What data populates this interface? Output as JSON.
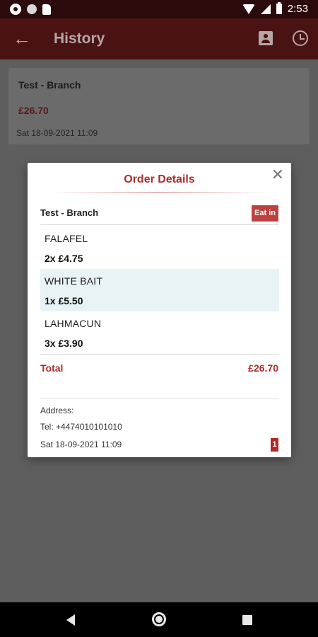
{
  "status_bar": {
    "time": "2:53",
    "icons": [
      "gear-icon",
      "dot-icon",
      "sd-card-icon",
      "wifi-icon",
      "signal-icon",
      "battery-icon"
    ]
  },
  "app_bar": {
    "title": "History",
    "back_icon": "arrow-left-icon",
    "actions": [
      "profile-icon",
      "history-icon"
    ],
    "background_color": "#4a1313"
  },
  "history_list": [
    {
      "branch": "Test - Branch",
      "total": "£26.70",
      "date": "Sat 18-09-2021 11:09"
    }
  ],
  "dialog": {
    "title": "Order Details",
    "branch": "Test - Branch",
    "order_type": "Eat in",
    "items": [
      {
        "name": "FALAFEL",
        "qty_price": "2x £4.75"
      },
      {
        "name": "WHITE BAIT",
        "qty_price": "1x £5.50"
      },
      {
        "name": "LAHMACUN",
        "qty_price": "3x £3.90"
      }
    ],
    "total_label": "Total",
    "total_value": "£26.70",
    "address_label": "Address:",
    "tel": "Tel: +4474010101010",
    "date": "Sat 18-09-2021 11:09",
    "badge": "1",
    "accent_color": "#b02a2a",
    "highlight_row_color": "#e8f3f6"
  },
  "nav_bar": {
    "buttons": [
      "back-triangle-icon",
      "home-circle-icon",
      "recents-square-icon"
    ]
  }
}
